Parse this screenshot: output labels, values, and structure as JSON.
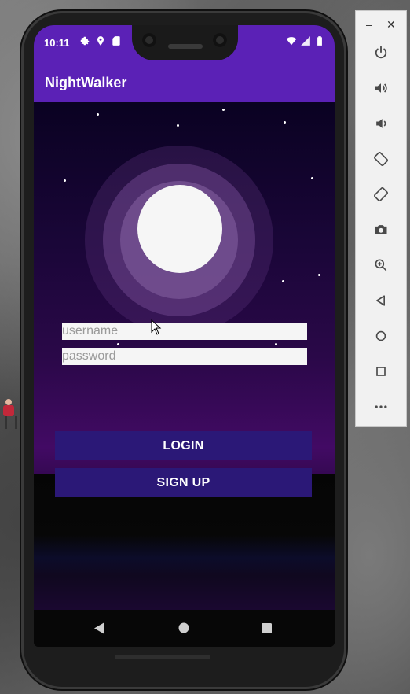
{
  "status_bar": {
    "time": "10:11",
    "left_icons": [
      "gear-icon",
      "location-icon",
      "sd-card-icon"
    ],
    "right_icons": [
      "wifi-icon",
      "signal-icon",
      "battery-icon"
    ]
  },
  "app_bar": {
    "title": "NightWalker",
    "color": "#5b21b6"
  },
  "login_form": {
    "username": {
      "value": "",
      "placeholder": "username"
    },
    "password": {
      "value": "",
      "placeholder": "password"
    },
    "login_label": "LOGIN",
    "signup_label": "SIGN UP",
    "button_color": "#2b1877"
  },
  "nav_bar": {
    "buttons": [
      "back-icon",
      "home-icon",
      "recents-icon"
    ]
  },
  "emulator_toolbar": {
    "window_controls": [
      "minimize-icon",
      "close-icon"
    ],
    "buttons": [
      "power-icon",
      "volume-up-icon",
      "volume-down-icon",
      "rotate-left-icon",
      "rotate-right-icon",
      "camera-icon",
      "zoom-icon",
      "back-icon",
      "home-icon",
      "overview-icon",
      "more-icon"
    ]
  }
}
